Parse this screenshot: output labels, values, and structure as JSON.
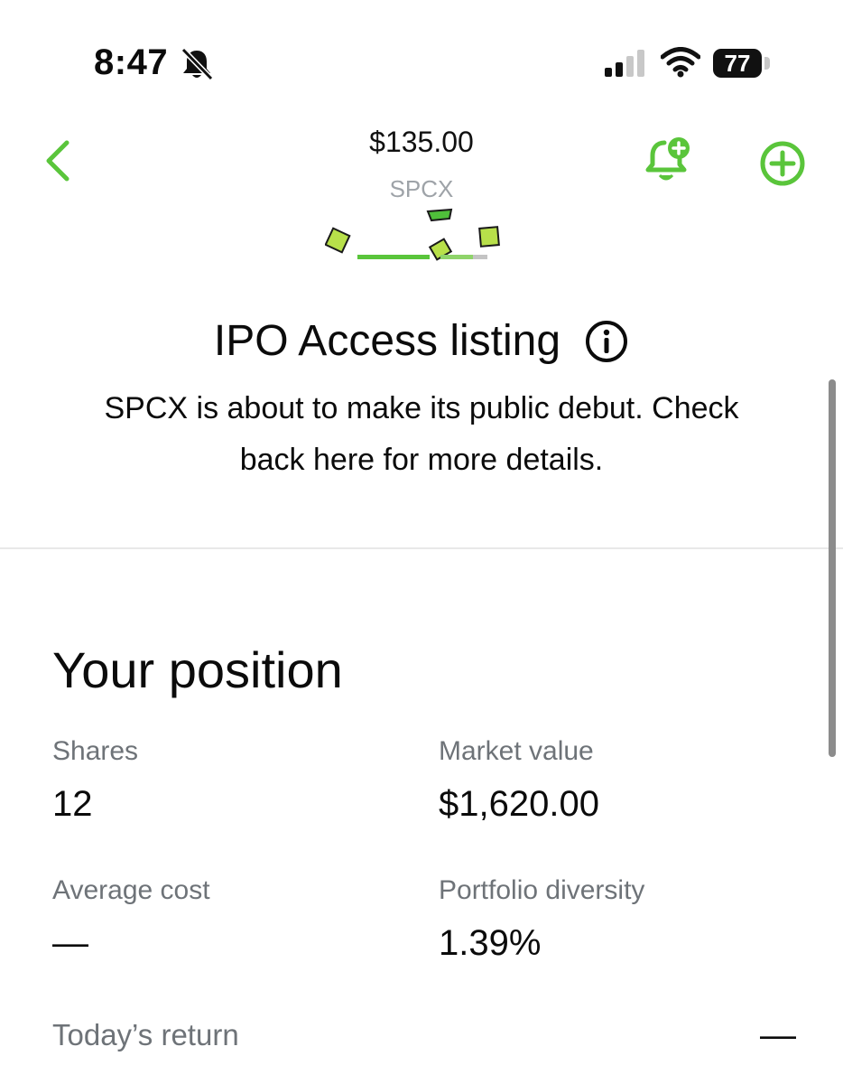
{
  "status_bar": {
    "time": "8:47",
    "battery": "77",
    "icons": [
      "bell-slash-icon",
      "cellular-signal-icon",
      "wifi-icon",
      "battery-icon"
    ]
  },
  "header": {
    "price": "$135.00",
    "symbol": "SPCX",
    "icons": [
      "chevron-left-icon",
      "bell-plus-icon",
      "plus-circle-icon"
    ]
  },
  "ipo": {
    "title": "IPO Access listing",
    "description": "SPCX is about to make its public debut. Check back here for more details.",
    "icon": "info-icon"
  },
  "position": {
    "title": "Your position",
    "shares_label": "Shares",
    "shares_value": "12",
    "market_value_label": "Market value",
    "market_value": "$1,620.00",
    "average_cost_label": "Average cost",
    "average_cost_value": "—",
    "portfolio_diversity_label": "Portfolio diversity",
    "portfolio_diversity_value": "1.39%",
    "todays_return_label": "Today’s return",
    "todays_return_value": "—"
  },
  "colors": {
    "accent": "#5ac53b",
    "text": "#0b0b0b",
    "muted": "#6e7378",
    "confetti": "#b8e04a"
  }
}
